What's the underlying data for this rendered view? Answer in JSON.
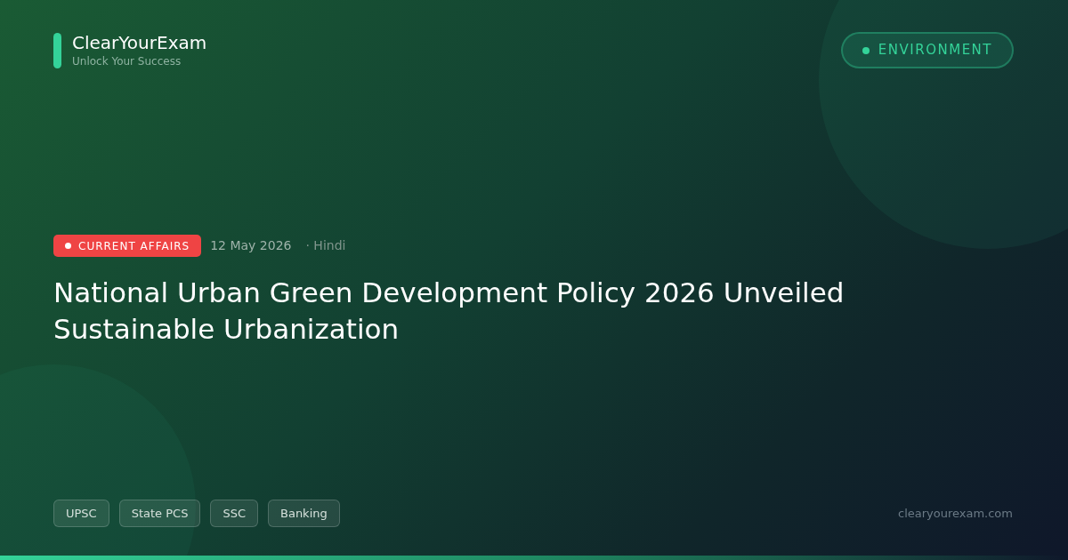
{
  "brand": {
    "name": "ClearYourExam",
    "tagline": "Unlock Your Success"
  },
  "category": {
    "label": "ENVIRONMENT"
  },
  "meta": {
    "badge": "CURRENT AFFAIRS",
    "date": "12 May 2026",
    "language": "· Hindi"
  },
  "title": "National Urban Green Development Policy 2026 Unveiled Sustainable Urbanization",
  "tags": [
    "UPSC",
    "State PCS",
    "SSC",
    "Banking"
  ],
  "site": "clearyourexam.com"
}
